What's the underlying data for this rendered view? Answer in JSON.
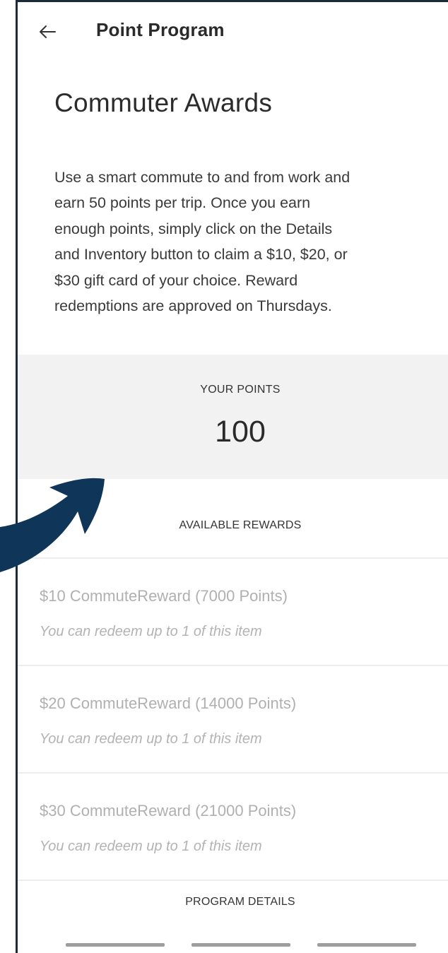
{
  "topbar": {
    "title": "Point Program",
    "back_icon": "arrow-left-icon"
  },
  "page": {
    "title": "Commuter Awards",
    "description_lines": [
      "Use a smart commute to and from work and",
      "earn 50 points per trip. Once you earn",
      "enough points, simply click on the Details",
      "and Inventory button to claim a $10, $20, or",
      "$30 gift card of your choice. Reward",
      "redemptions are approved on Thursdays."
    ]
  },
  "points": {
    "label": "YOUR POINTS",
    "value": "100"
  },
  "rewards": {
    "header": "AVAILABLE REWARDS",
    "items": [
      {
        "name": "$10 CommuteReward (7000 Points)",
        "note": "You can redeem up to 1 of this item"
      },
      {
        "name": "$20 CommuteReward (14000 Points)",
        "note": "You can redeem up to 1 of this item"
      },
      {
        "name": "$30 CommuteReward (21000 Points)",
        "note": "You can redeem up to 1 of this item"
      }
    ]
  },
  "program_details": {
    "label": "PROGRAM DETAILS"
  },
  "colors": {
    "frame": "#1c2b3a",
    "annotation_arrow": "#0f3558",
    "points_panel_bg": "#f2f2f2",
    "disabled_text": "#b0b0b0"
  }
}
